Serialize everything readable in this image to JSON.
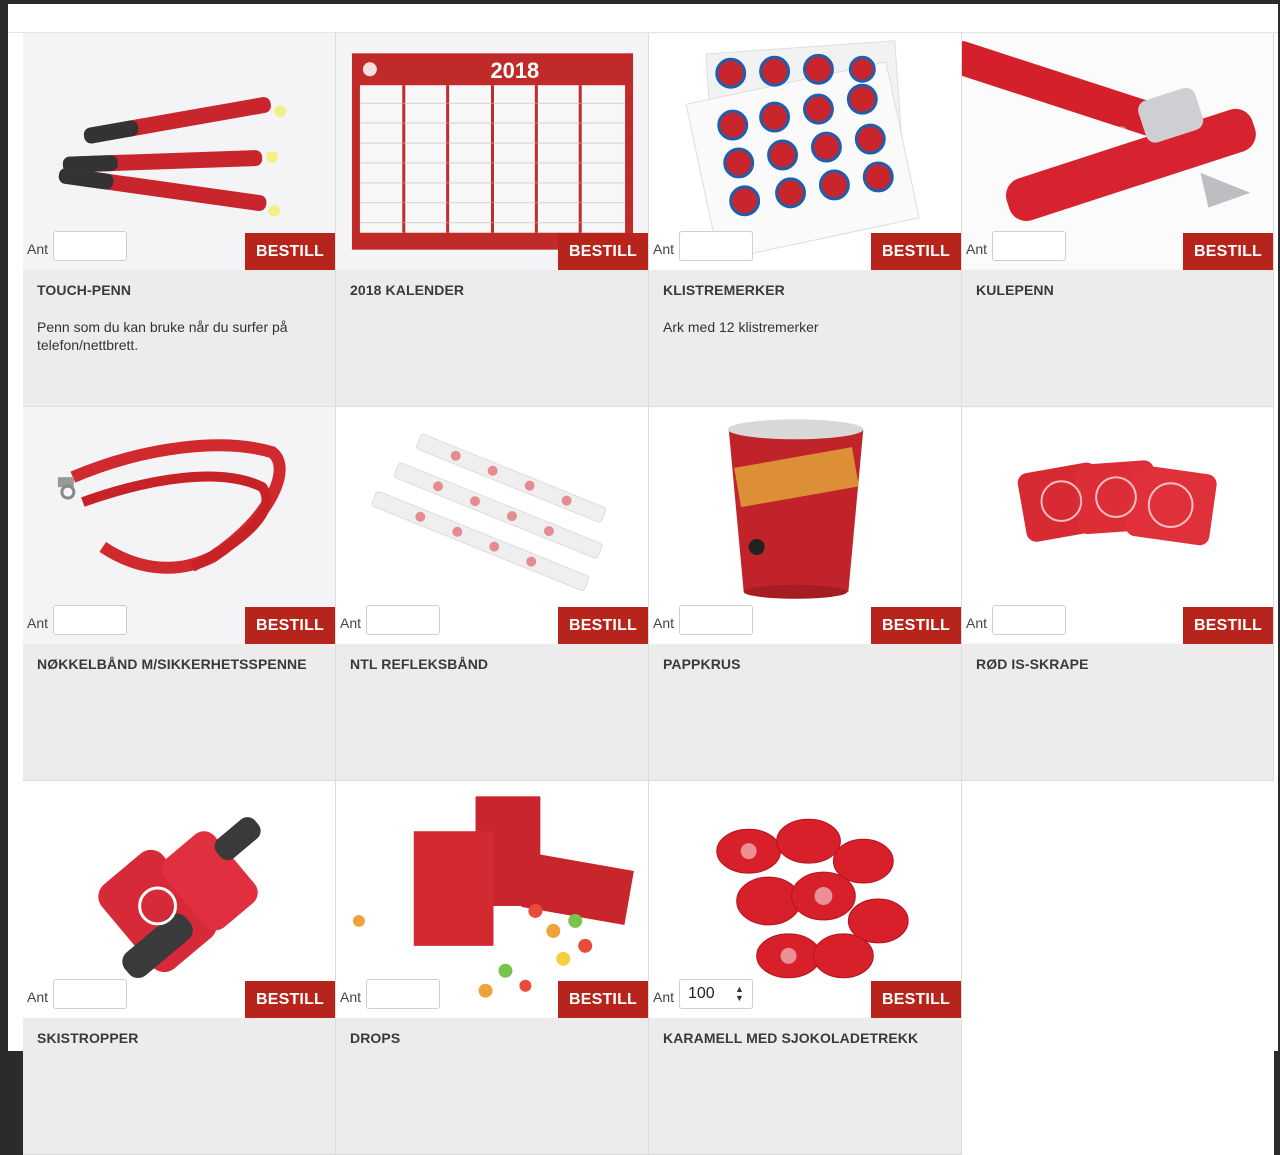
{
  "colors": {
    "accent": "#b7241c",
    "info_bg": "#ececec"
  },
  "labels": {
    "ant": "Ant",
    "order_button": "BESTILL"
  },
  "products": [
    {
      "title": "TOUCH-PENN",
      "description": "Penn som du kan bruke når du surfer på telefon/nettbrett.",
      "quantity": "",
      "image": "pens-icon"
    },
    {
      "title": "2018 KALENDER",
      "description": "",
      "quantity": "",
      "image": "calendar-icon",
      "image_text": "2018"
    },
    {
      "title": "KLISTREMERKER",
      "description": "Ark med 12 klistremerker",
      "quantity": "",
      "image": "stickers-icon"
    },
    {
      "title": "KULEPENN",
      "description": "",
      "quantity": "",
      "image": "ballpen-icon"
    },
    {
      "title": "NØKKELBÅND M/SIKKERHETSSPENNE",
      "description": "",
      "quantity": "",
      "image": "lanyard-icon"
    },
    {
      "title": "NTL REFLEKSBÅND",
      "description": "",
      "quantity": "",
      "image": "reflective-band-icon"
    },
    {
      "title": "PAPPKRUS",
      "description": "",
      "quantity": "",
      "image": "paper-cup-icon"
    },
    {
      "title": "RØD IS-SKRAPE",
      "description": "",
      "quantity": "",
      "image": "ice-scraper-icon"
    },
    {
      "title": "SKISTROPPER",
      "description": "",
      "quantity": "",
      "image": "ski-straps-icon"
    },
    {
      "title": "DROPS",
      "description": "",
      "quantity": "",
      "image": "candy-box-icon"
    },
    {
      "title": "KARAMELL MED SJOKOLADETREKK",
      "description": "",
      "quantity": "100",
      "image": "caramel-icon"
    }
  ]
}
